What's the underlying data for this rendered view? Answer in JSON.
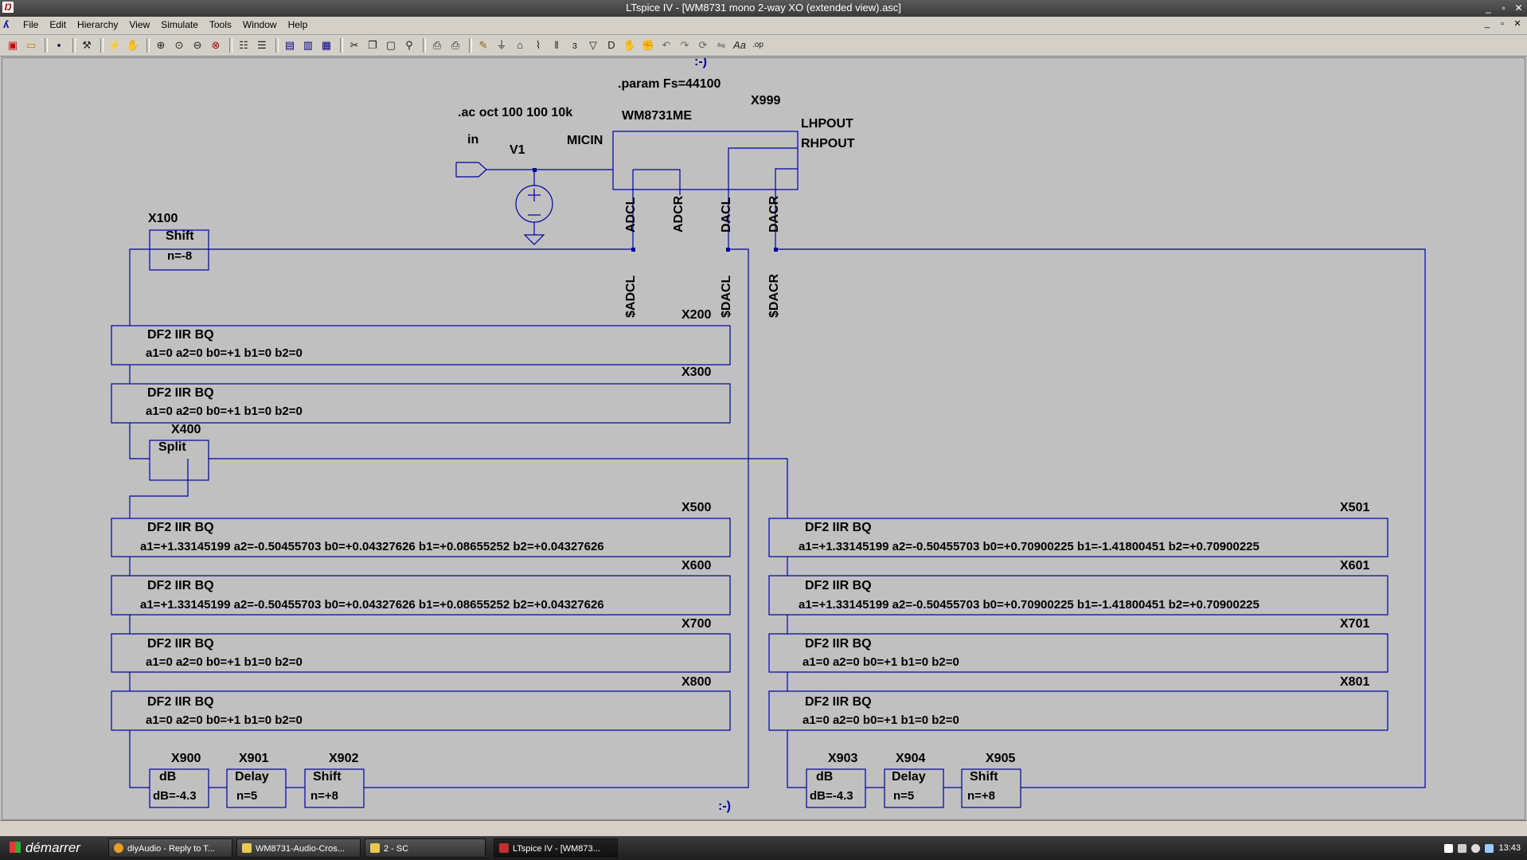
{
  "window": {
    "title": "LTspice IV - [WM8731 mono 2-way XO (extended view).asc]",
    "controls": [
      "_",
      "▫",
      "✕"
    ],
    "mdi_controls": [
      "_",
      "▫",
      "✕"
    ]
  },
  "menu": [
    "File",
    "Edit",
    "Hierarchy",
    "View",
    "Simulate",
    "Tools",
    "Window",
    "Help"
  ],
  "toolbar_icons": [
    "new-schematic-icon",
    "open-icon",
    "save-icon",
    "control-panel-icon",
    "run-icon",
    "halt-icon",
    "zoom-in-icon",
    "zoom-area-icon",
    "zoom-out-icon",
    "zoom-fit-icon",
    "autorange-icon",
    "measure-icon",
    "tile-horizontal-icon",
    "tile-vertical-icon",
    "cascade-icon",
    "cut-icon",
    "copy-icon",
    "paste-icon",
    "find-icon",
    "print-preview-icon",
    "print-icon",
    "draw-wire-icon",
    "ground-icon",
    "label-net-icon",
    "resistor-icon",
    "capacitor-icon",
    "inductor-icon",
    "diode-icon",
    "component-icon",
    "move-icon",
    "drag-icon",
    "undo-icon",
    "redo-icon",
    "rotate-icon",
    "mirror-icon",
    "text-icon",
    "spice-directive-icon"
  ],
  "schematic": {
    "smiley_top": ":-)",
    "smiley_bottom": ":-)",
    "param": ".param Fs=44100",
    "ac": ".ac oct 100 100 10k",
    "codec": {
      "ref": "X999",
      "name": "WM8731ME",
      "pins": {
        "micin": "MICIN",
        "lhpout": "LHPOUT",
        "rhpout": "RHPOUT",
        "adcl": "ADCL",
        "adcr": "ADCR",
        "dacl": "DACL",
        "dacr": "DACR"
      }
    },
    "source": {
      "ref": "V1",
      "port": "in"
    },
    "nets": {
      "adcl": "$ADCL",
      "dacl": "$DACL",
      "dacr": "$DACR"
    },
    "x100": {
      "ref": "X100",
      "name": "Shift",
      "param": "n=-8"
    },
    "x400": {
      "ref": "X400",
      "name": "Split"
    },
    "x200": {
      "ref": "X200",
      "name": "DF2 IIR BQ",
      "param": "a1=0 a2=0 b0=+1 b1=0 b2=0"
    },
    "x300": {
      "ref": "X300",
      "name": "DF2 IIR BQ",
      "param": "a1=0 a2=0 b0=+1 b1=0 b2=0"
    },
    "x500": {
      "ref": "X500",
      "name": "DF2 IIR BQ",
      "param": "a1=+1.33145199 a2=-0.50455703 b0=+0.04327626 b1=+0.08655252 b2=+0.04327626"
    },
    "x600": {
      "ref": "X600",
      "name": "DF2 IIR BQ",
      "param": "a1=+1.33145199 a2=-0.50455703 b0=+0.04327626 b1=+0.08655252 b2=+0.04327626"
    },
    "x700": {
      "ref": "X700",
      "name": "DF2 IIR BQ",
      "param": "a1=0 a2=0 b0=+1 b1=0 b2=0"
    },
    "x800": {
      "ref": "X800",
      "name": "DF2 IIR BQ",
      "param": "a1=0 a2=0 b0=+1 b1=0 b2=0"
    },
    "x501": {
      "ref": "X501",
      "name": "DF2 IIR BQ",
      "param": "a1=+1.33145199 a2=-0.50455703 b0=+0.70900225 b1=-1.41800451 b2=+0.70900225"
    },
    "x601": {
      "ref": "X601",
      "name": "DF2 IIR BQ",
      "param": "a1=+1.33145199 a2=-0.50455703 b0=+0.70900225 b1=-1.41800451 b2=+0.70900225"
    },
    "x701": {
      "ref": "X701",
      "name": "DF2 IIR BQ",
      "param": "a1=0 a2=0 b0=+1 b1=0 b2=0"
    },
    "x801": {
      "ref": "X801",
      "name": "DF2 IIR BQ",
      "param": "a1=0 a2=0 b0=+1 b1=0 b2=0"
    },
    "x900": {
      "ref": "X900",
      "name": "dB",
      "param": "dB=-4.3"
    },
    "x901": {
      "ref": "X901",
      "name": "Delay",
      "param": "n=5"
    },
    "x902": {
      "ref": "X902",
      "name": "Shift",
      "param": "n=+8"
    },
    "x903": {
      "ref": "X903",
      "name": "dB",
      "param": "dB=-4.3"
    },
    "x904": {
      "ref": "X904",
      "name": "Delay",
      "param": "n=5"
    },
    "x905": {
      "ref": "X905",
      "name": "Shift",
      "param": "n=+8"
    }
  },
  "taskbar": {
    "start": "démarrer",
    "tasks": [
      "diyAudio - Reply to T...",
      "WM8731-Audio-Cros...",
      "2 - SC",
      "LTspice IV - [WM873..."
    ],
    "clock": "13:43"
  }
}
